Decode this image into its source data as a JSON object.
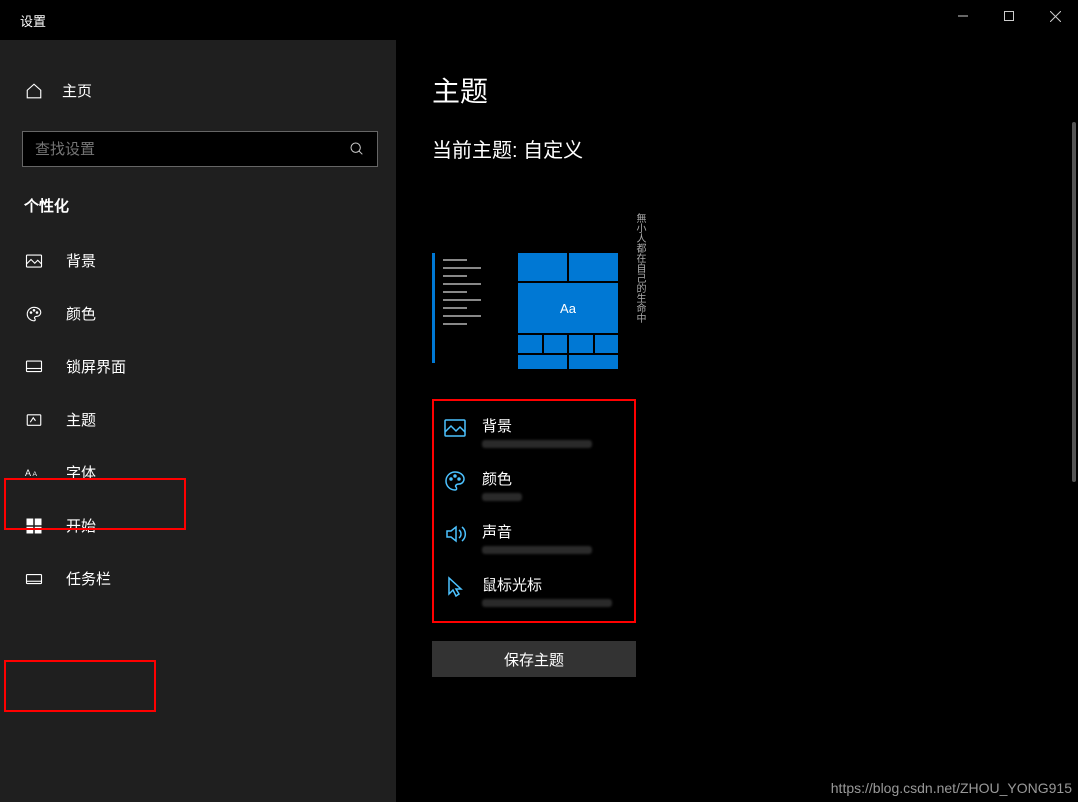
{
  "window": {
    "title": "设置"
  },
  "home": {
    "label": "主页"
  },
  "search": {
    "placeholder": "查找设置"
  },
  "section": {
    "label": "个性化"
  },
  "nav": {
    "background": "背景",
    "colors": "颜色",
    "lockscreen": "锁屏界面",
    "theme": "主题",
    "fonts": "字体",
    "start": "开始",
    "taskbar": "任务栏"
  },
  "main": {
    "heading": "主题",
    "subtitle": "当前主题: 自定义",
    "preview_tile_text": "Aa",
    "opts": {
      "background": "背景",
      "color": "颜色",
      "sound": "声音",
      "cursor": "鼠标光标"
    },
    "save": "保存主题"
  },
  "watermark": "https://blog.csdn.net/ZHOU_YONG915"
}
